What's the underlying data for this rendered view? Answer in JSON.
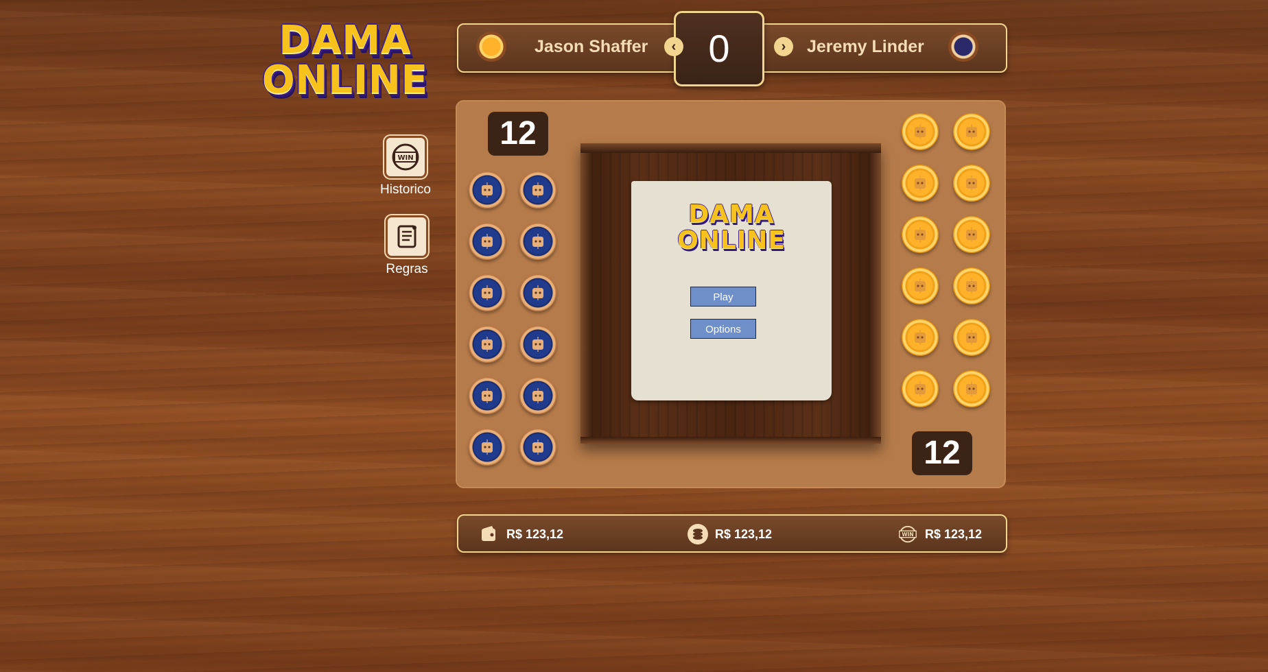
{
  "logo": {
    "line1": "DAMA",
    "line2": "ONLINE"
  },
  "sidebar": {
    "items": [
      {
        "label": "Historico",
        "icon": "win-badge-icon"
      },
      {
        "label": "Regras",
        "icon": "scroll-rules-icon"
      }
    ]
  },
  "header": {
    "player1": {
      "name": "Jason Shaffer",
      "avatar": "gold-piece-avatar"
    },
    "player2": {
      "name": "Jeremy Linder",
      "avatar": "blue-piece-avatar"
    },
    "score": "0",
    "prev_icon": "‹",
    "next_icon": "›"
  },
  "panel": {
    "left_count": "12",
    "right_count": "12",
    "left_pieces_color": "blue",
    "right_pieces_color": "gold"
  },
  "board": {
    "paper_logo_line1": "DAMA",
    "paper_logo_line2": "ONLINE",
    "play_label": "Play",
    "options_label": "Options"
  },
  "footer": {
    "stats": [
      {
        "icon": "wallet-icon",
        "value": "R$ 123,12"
      },
      {
        "icon": "coin-stack-icon",
        "value": "R$ 123,12"
      },
      {
        "icon": "win-badge-icon",
        "value": "R$ 123,12"
      }
    ]
  },
  "colors": {
    "accent_gold": "#f7c21b",
    "board_panel": "#b67b4a",
    "button_blue": "#6f8fca",
    "border_cream": "#f2d58e"
  }
}
